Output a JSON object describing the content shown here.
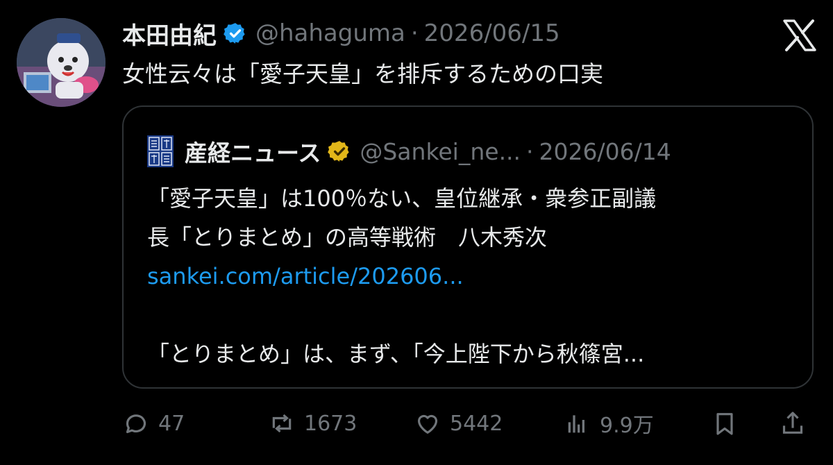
{
  "tweet": {
    "author_name": "本田由紀",
    "handle": "@hahaguma",
    "separator": "·",
    "date": "2026/06/15",
    "text": "女性云々は「愛子天皇」を排斥するための口実"
  },
  "quoted": {
    "author_name": "産経ニュース",
    "handle": "@Sankei_ne...",
    "separator": "·",
    "date": "2026/06/14",
    "lines": [
      "「愛子天皇」は100％ない、皇位継承・衆参正副議",
      "長「とりまとめ」の高等戦術　八木秀次"
    ],
    "link": "sankei.com/article/202606...",
    "excerpt": "「とりまとめ」は、まず、「今上陛下から秋篠宮..."
  },
  "actions": {
    "replies": "47",
    "reposts": "1673",
    "likes": "5442",
    "views": "9.9万"
  },
  "icons": {
    "verified_author": "verified-blue-badge-icon",
    "verified_quoted": "verified-gold-badge-icon",
    "brand": "x-logo-icon",
    "reply": "reply-icon",
    "repost": "repost-icon",
    "like": "heart-icon",
    "views": "views-icon",
    "bookmark": "bookmark-icon",
    "share": "share-icon"
  },
  "colors": {
    "background": "#000000",
    "text": "#e7e9ea",
    "muted": "#71767b",
    "link": "#1d9bf0",
    "verified_blue": "#1d9bf0",
    "verified_gold": "#e2b719",
    "border": "#2f3336"
  }
}
